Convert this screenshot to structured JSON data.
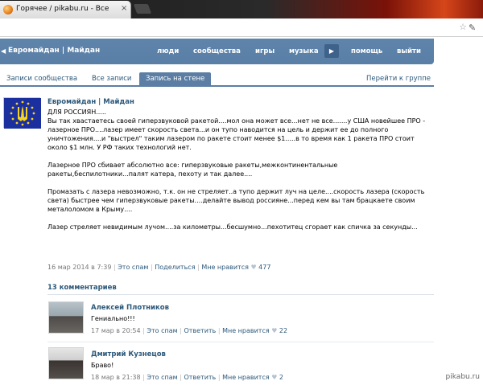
{
  "browser": {
    "tab_title": "Горячее / pikabu.ru - Все",
    "tab_close": "×"
  },
  "vk": {
    "group_name": "Евромайдан | Майдан",
    "nav": {
      "people": "люди",
      "communities": "сообщества",
      "games": "игры",
      "music": "музыка",
      "help": "помощь",
      "logout": "выйти"
    },
    "play_glyph": "▶"
  },
  "tabs": {
    "community_posts": "Записи сообщества",
    "all_posts": "Все записи",
    "wall_post": "Запись на стене",
    "goto_group": "Перейти к группе"
  },
  "post": {
    "author": "Евромайдан | Майдан",
    "paragraphs": [
      "ДЛЯ РОССИЯН.....",
      "Вы так хвастаетесь своей гиперзвуковой ракетой....мол она может все...нет не все.......у США новейшее ПРО - лазерное ПРО....лазер имеет скорость света...и он тупо наводится на цель и держит ее до полного уничтожения....и \"выстрел\" таким лазером по ракете стоит менее $1.....в то время как 1 ракета ПРО стоит около $1 млн. У РФ таких технологий нет.",
      "Лазерное ПРО сбивает абсолютно все: гиперзвуковые ракеты,межконтинентальные ракеты,беспилотники...палят катера, пехоту и так далее....",
      "Промазать с лазера невозможно, т.к. он не стреляет..а тупо держит луч на целе....скорость лазера (скорость света) быстрее чем гиперзвуковые ракеты....делайте вывод россияне...перед кем вы там брацкаете своим металоломом в Крыму....",
      "Лазер стреляет невидимым лучом....за километры...бесшумно...пехотитец сгорает как спичка за секунды..."
    ],
    "meta": {
      "date": "16 мар 2014 в 7:39",
      "spam": "Это спам",
      "share": "Поделиться",
      "like": "Мне нравится",
      "likes_count": "477",
      "sep": "|"
    }
  },
  "comments": {
    "header": "13 комментариев",
    "items": [
      {
        "name": "Алексей Плотников",
        "text": "Гениально!!!",
        "date": "17 мар в 20:54",
        "spam": "Это спам",
        "reply": "Ответить",
        "like": "Мне нравится",
        "likes_count": "22"
      },
      {
        "name": "Дмитрий Кузнецов",
        "text": "Браво!",
        "date": "18 мар в 21:38",
        "spam": "Это спам",
        "reply": "Ответить",
        "like": "Мне нравится",
        "likes_count": "2"
      }
    ]
  },
  "watermark": "pikabu.ru",
  "icons": {
    "heart": "♥",
    "left_arrow": "◀",
    "star": "☆",
    "wrench": "✎"
  }
}
